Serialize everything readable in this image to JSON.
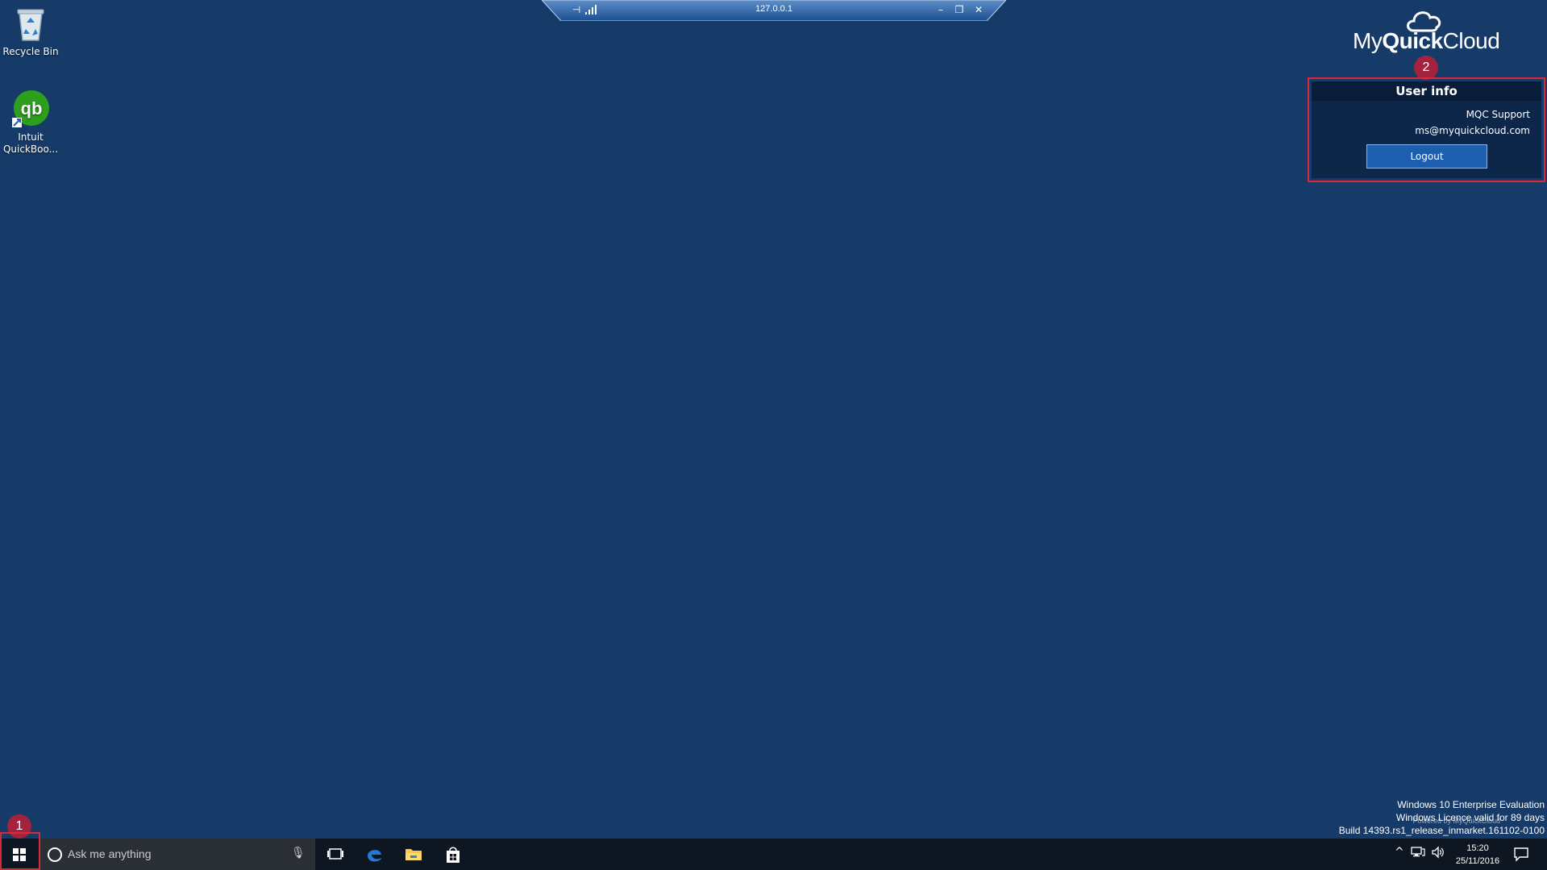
{
  "desktop": {
    "background_color": "#163b69",
    "icons": [
      {
        "label": "Recycle Bin",
        "icon": "recycle-bin-icon"
      },
      {
        "label": "Intuit QuickBoo...",
        "icon": "quickbooks-icon"
      }
    ]
  },
  "connection_bar": {
    "host": "127.0.0.1",
    "icons": [
      "pin-icon",
      "signal-icon",
      "minimize-icon",
      "restore-icon",
      "close-icon"
    ]
  },
  "brand": {
    "prefix": "My",
    "bold": "Quick",
    "suffix": "Cloud"
  },
  "annotations": {
    "marker_1": "1",
    "marker_2": "2",
    "highlight_color": "#d9283b",
    "marker_color": "#a3223d"
  },
  "user_info": {
    "title": "User info",
    "name": "MQC Support",
    "email": "ms@myquickcloud.com",
    "logout_label": "Logout"
  },
  "watermark": {
    "line1": "Windows 10 Enterprise Evaluation",
    "line2": "Windows Licence valid for 89 days",
    "line3": "Build 14393.rs1_release_inmarket.161102-0100",
    "powered": "Powered by MyQuickCloud"
  },
  "taskbar": {
    "search_placeholder": "Ask me anything",
    "pinned": [
      "task-view-icon",
      "edge-icon",
      "file-explorer-icon",
      "store-icon"
    ],
    "clock_time": "15:20",
    "clock_date": "25/11/2016"
  }
}
